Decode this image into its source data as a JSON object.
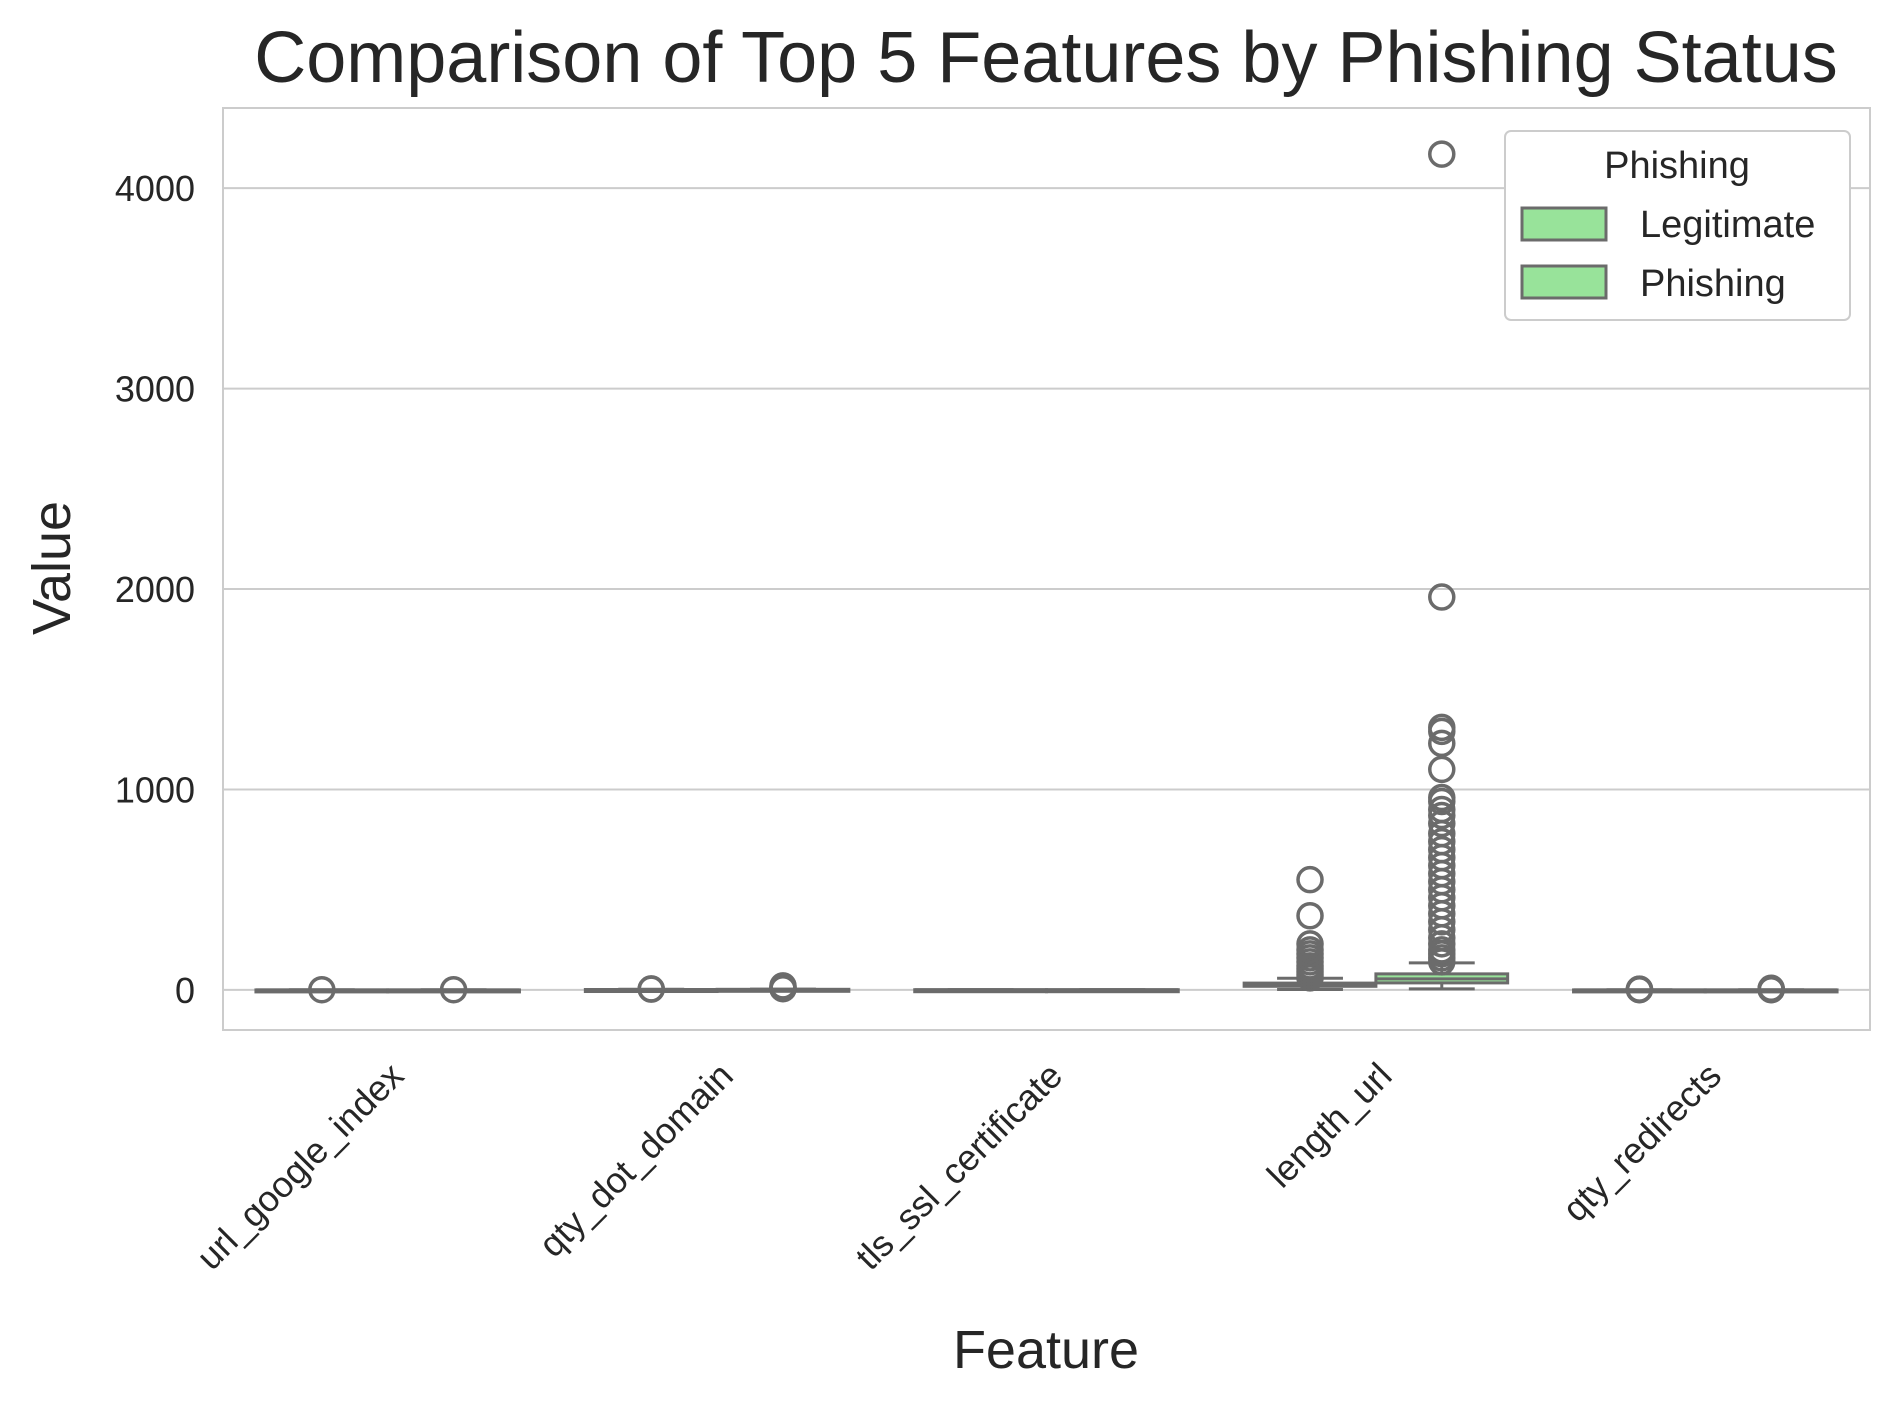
{
  "chart_data": {
    "type": "box",
    "title": "Comparison of Top 5 Features by Phishing Status",
    "xlabel": "Feature",
    "ylabel": "Value",
    "ylim": [
      -200,
      4400
    ],
    "yticks": [
      0,
      1000,
      2000,
      3000,
      4000
    ],
    "grid": "horizontal",
    "legend": {
      "title": "Phishing",
      "placement": "top-right"
    },
    "categories": [
      "url_google_index",
      "qty_dot_domain",
      "tls_ssl_certificate",
      "length_url",
      "qty_redirects"
    ],
    "series": [
      {
        "name": "Legitimate",
        "color": "#98e39a",
        "boxes": [
          {
            "whisker_low": 0,
            "q1": 0,
            "median": 0,
            "q3": 0,
            "whisker_high": 0,
            "outliers": [
              1
            ]
          },
          {
            "whisker_low": 1,
            "q1": 2,
            "median": 2,
            "q3": 2,
            "whisker_high": 3,
            "outliers": [
              4,
              5
            ]
          },
          {
            "whisker_low": 0,
            "q1": 0,
            "median": 1,
            "q3": 1,
            "whisker_high": 1,
            "outliers": []
          },
          {
            "whisker_low": 2,
            "q1": 18,
            "median": 25,
            "q3": 34,
            "whisker_high": 58,
            "outliers": [
              60,
              75,
              90,
              105,
              120,
              140,
              160,
              180,
              200,
              230,
              370,
              550
            ]
          },
          {
            "whisker_low": 0,
            "q1": 0,
            "median": 0,
            "q3": 0,
            "whisker_high": 0,
            "outliers": [
              1,
              2,
              3,
              4
            ]
          }
        ]
      },
      {
        "name": "Phishing",
        "color": "#98e39a",
        "boxes": [
          {
            "whisker_low": 0,
            "q1": 0,
            "median": 0,
            "q3": 0,
            "whisker_high": 0,
            "outliers": [
              1
            ]
          },
          {
            "whisker_low": 1,
            "q1": 2,
            "median": 2,
            "q3": 3,
            "whisker_high": 4,
            "outliers": [
              6,
              8,
              10,
              15,
              20
            ]
          },
          {
            "whisker_low": 0,
            "q1": 0,
            "median": 1,
            "q3": 1,
            "whisker_high": 1,
            "outliers": []
          },
          {
            "whisker_low": 5,
            "q1": 35,
            "median": 55,
            "q3": 80,
            "whisker_high": 135,
            "outliers": [
              140,
              160,
              180,
              200,
              230,
              260,
              300,
              340,
              380,
              420,
              460,
              500,
              540,
              580,
              620,
              660,
              700,
              740,
              780,
              830,
              870,
              900,
              940,
              960,
              1100,
              1230,
              1290,
              1310,
              1960,
              4170
            ]
          },
          {
            "whisker_low": 0,
            "q1": 0,
            "median": 0,
            "q3": 0,
            "whisker_high": 0,
            "outliers": [
              1,
              2,
              3,
              5,
              8
            ]
          }
        ]
      }
    ]
  },
  "colors": {
    "box_fill": "#98e39a",
    "box_edge": "#6b6b6b",
    "grid": "#cccccc",
    "spine": "#cccccc",
    "text": "#262626"
  }
}
